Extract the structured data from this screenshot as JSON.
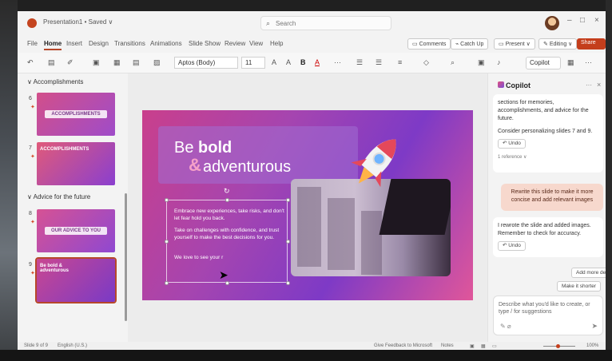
{
  "titlebar": {
    "doc_title": "Presentation1 • Saved ∨",
    "search_placeholder": "Search",
    "min": "–",
    "max": "□",
    "close": "×"
  },
  "menu": {
    "tabs": [
      "File",
      "Home",
      "Insert",
      "Design",
      "Transitions",
      "Animations",
      "Slide Show",
      "Review",
      "View",
      "Help"
    ],
    "active_tab": "Home",
    "comments": "Comments",
    "catch_up": "Catch Up",
    "present": "Present ∨",
    "editing": "Editing ∨",
    "share": "Share"
  },
  "ribbon": {
    "font_name": "Aptos (Body)",
    "font_size": "11",
    "copilot": "Copilot"
  },
  "thumbs": {
    "section1": "Accomplishments",
    "section2": "Advice for the future",
    "slides": [
      {
        "num": "6",
        "label": "ACCOMPLISHMENTS"
      },
      {
        "num": "7",
        "label": "ACCOMPLISHMENTS"
      },
      {
        "num": "8",
        "label": "OUR ADVICE TO YOU"
      },
      {
        "num": "9",
        "label": "Be bold & adventurous"
      }
    ]
  },
  "slide": {
    "title_part1": "Be ",
    "title_bold": "bold",
    "amp": "&",
    "title_part2": "adventurous",
    "body": [
      "Embrace new experiences, take risks, and don't let fear hold you back.",
      "Take on challenges with confidence, and trust yourself to make the best decisions for you.",
      "We love to see your r"
    ]
  },
  "copilot": {
    "title": "Copilot",
    "msg1": "sections for memories, accomplishments, and advice for the future.",
    "msg1b": "Consider personalizing slides 7 and 9.",
    "undo": "Undo",
    "reference": "1 reference ∨",
    "prompt": "Rewrite this slide to make it more concise and add relevant images",
    "msg2": "I rewrote the slide and added images. Remember to check for accuracy.",
    "suggestions": [
      "Add more detail",
      "Make it shorter"
    ],
    "input_placeholder": "Describe what you'd like to create, or type / for suggestions"
  },
  "status": {
    "slide_info": "Slide 9 of 9",
    "language": "English (U.S.)",
    "feedback": "Give Feedback to Microsoft",
    "notes": "Notes",
    "zoom": "100%"
  }
}
